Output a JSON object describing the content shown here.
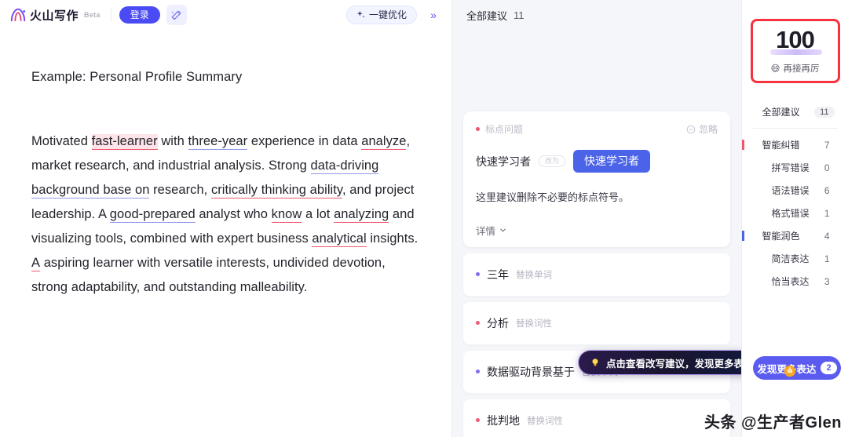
{
  "topbar": {
    "logo_text": "火山写作",
    "logo_icon": "volcano-logo-icon",
    "beta_badge": "Beta",
    "login_label": "登录",
    "wand_icon": "magic-wand-icon",
    "optimize_label": "一键优化",
    "sparkle_icon": "sparkle-icon",
    "collapse_icon": "chevron-double-right-icon",
    "collapse_label": "»"
  },
  "document": {
    "title": "Example: Personal Profile Summary",
    "paragraph": [
      {
        "text": "Motivated ",
        "mark": "none"
      },
      {
        "text": "fast-learner",
        "mark": "red-fill"
      },
      {
        "text": " with ",
        "mark": "none"
      },
      {
        "text": "three-year",
        "mark": "blue"
      },
      {
        "text": " experience in data ",
        "mark": "none"
      },
      {
        "text": "analyze",
        "mark": "red"
      },
      {
        "text": ", market research, and industrial analysis. Strong ",
        "mark": "none"
      },
      {
        "text": "data-driving background base on",
        "mark": "blue"
      },
      {
        "text": " research, ",
        "mark": "none"
      },
      {
        "text": "critically thinking ability",
        "mark": "red"
      },
      {
        "text": ", and project leadership. A ",
        "mark": "none"
      },
      {
        "text": "good-prepared",
        "mark": "blue"
      },
      {
        "text": " analyst who ",
        "mark": "none"
      },
      {
        "text": "know",
        "mark": "red"
      },
      {
        "text": " a lot ",
        "mark": "none"
      },
      {
        "text": "analyzing",
        "mark": "red"
      },
      {
        "text": " and visualizing tools, combined with expert business ",
        "mark": "none"
      },
      {
        "text": "analytical",
        "mark": "red"
      },
      {
        "text": " insights. ",
        "mark": "none"
      },
      {
        "text": "A",
        "mark": "red"
      },
      {
        "text": " aspiring learner with versatile interests, undivided devotion, strong adaptability, and outstanding malleability.",
        "mark": "none"
      }
    ]
  },
  "suggestions": {
    "header_title": "全部建议",
    "header_count": "11",
    "card": {
      "tag": "标点问题",
      "dot_icon": "red-dot-icon",
      "ignore_label": "忽略",
      "ignore_icon": "circle-minus-icon",
      "original": "快速学习者",
      "arrow_label": "改为",
      "arrow_icon": "arrow-right-icon",
      "replacement": "快速学习者",
      "explanation": "这里建议删除不必要的标点符号。",
      "details_label": "详情",
      "details_icon": "chevron-down-icon"
    },
    "items": [
      {
        "dot": "violet",
        "word": "三年",
        "kind": "替换单词"
      },
      {
        "dot": "pink",
        "word": "分析",
        "kind": "替换词性"
      },
      {
        "dot": "violet",
        "word": "数据驱动背景基于",
        "kind": "替换单词"
      },
      {
        "dot": "pink",
        "word": "批判地",
        "kind": "替换词性"
      }
    ],
    "tooltip": {
      "icon": "lightbulb-icon",
      "text": "点击查看改写建议，发现更多表达"
    }
  },
  "sidebar": {
    "score": {
      "value": "100",
      "emoji": "😄",
      "label": "再接再厉"
    },
    "nav": [
      {
        "label": "全部建议",
        "count": "11",
        "style": "pill",
        "level": "top",
        "marker": "none"
      },
      {
        "label": "智能纠错",
        "count": "7",
        "style": "plain",
        "level": "top",
        "marker": "red"
      },
      {
        "label": "拼写错误",
        "count": "0",
        "style": "plain",
        "level": "sub",
        "marker": "none"
      },
      {
        "label": "语法错误",
        "count": "6",
        "style": "plain",
        "level": "sub",
        "marker": "none"
      },
      {
        "label": "格式错误",
        "count": "1",
        "style": "plain",
        "level": "sub",
        "marker": "none"
      },
      {
        "label": "智能润色",
        "count": "4",
        "style": "plain",
        "level": "top",
        "marker": "blue"
      },
      {
        "label": "简洁表达",
        "count": "1",
        "style": "plain",
        "level": "sub",
        "marker": "none"
      },
      {
        "label": "恰当表达",
        "count": "3",
        "style": "plain",
        "level": "sub",
        "marker": "none"
      }
    ],
    "discover": {
      "label": "发现更多表达",
      "count": "2",
      "cursor_icon": "hand-cursor-icon"
    }
  },
  "watermark": {
    "text": "头条 @生产者Glen"
  },
  "colors": {
    "brand_purple": "#4b4bf5",
    "accent_blue": "#4b63e8",
    "error_red": "#f0576e",
    "highlight_red_bg": "#fde4e8",
    "annotation_red": "#f5333f",
    "polish_violet": "#7b6cf0"
  }
}
